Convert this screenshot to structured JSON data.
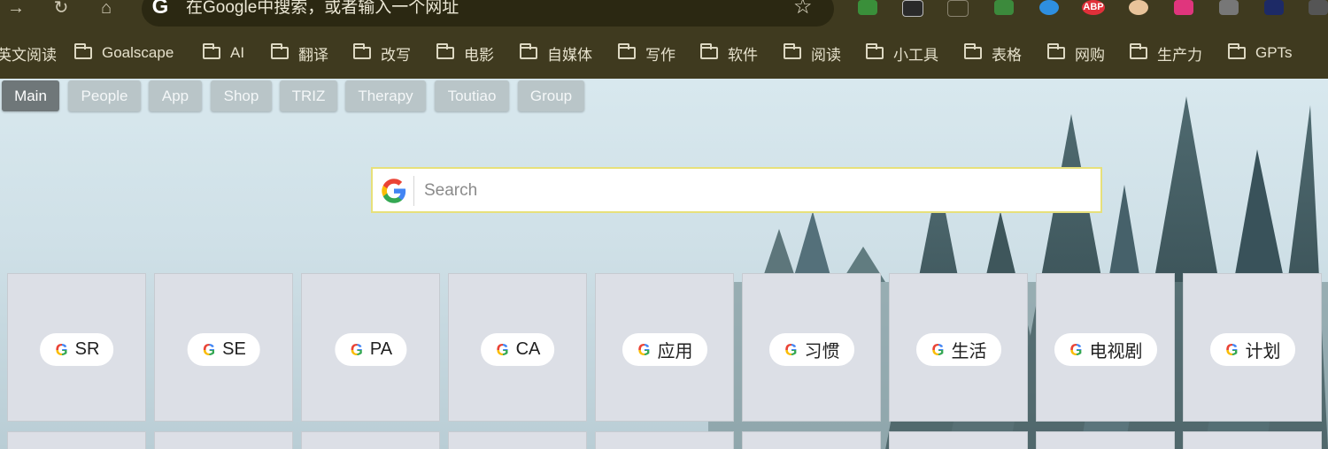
{
  "browser": {
    "omnibox_placeholder": "在Google中搜索，或者输入一个网址",
    "extensions": [
      "puzzle-extension-icon",
      "binoculars-extension-icon",
      "copy-extension-icon",
      "clipboard-extension-icon",
      "safari-extension-icon",
      "abp-extension-icon",
      "mask-extension-icon",
      "translate-extension-icon",
      "screenshot-extension-icon",
      "ghost-extension-icon",
      "cursor-extension-icon"
    ],
    "abp_label": "ABP"
  },
  "bookmarks": [
    {
      "label": "英文阅读",
      "folder": false
    },
    {
      "label": "Goalscape",
      "folder": true
    },
    {
      "label": "AI",
      "folder": true
    },
    {
      "label": "翻译",
      "folder": true
    },
    {
      "label": "改写",
      "folder": true
    },
    {
      "label": "电影",
      "folder": true
    },
    {
      "label": "自媒体",
      "folder": true
    },
    {
      "label": "写作",
      "folder": true
    },
    {
      "label": "软件",
      "folder": true
    },
    {
      "label": "阅读",
      "folder": true
    },
    {
      "label": "小工具",
      "folder": true
    },
    {
      "label": "表格",
      "folder": true
    },
    {
      "label": "网购",
      "folder": true
    },
    {
      "label": "生产力",
      "folder": true
    },
    {
      "label": "GPTs",
      "folder": true
    }
  ],
  "tabs": [
    "Main",
    "People",
    "App",
    "Shop",
    "TRIZ",
    "Therapy",
    "Toutiao",
    "Group"
  ],
  "active_tab": "Main",
  "search": {
    "placeholder": "Search"
  },
  "tiles": [
    "SR",
    "SE",
    "PA",
    "CA",
    "应用",
    "习惯",
    "生活",
    "电视剧",
    "计划"
  ],
  "colors": {
    "toolbar": "#3f3a1f",
    "tile_bg": "#dcdfe6",
    "search_border": "#e7e07a"
  }
}
